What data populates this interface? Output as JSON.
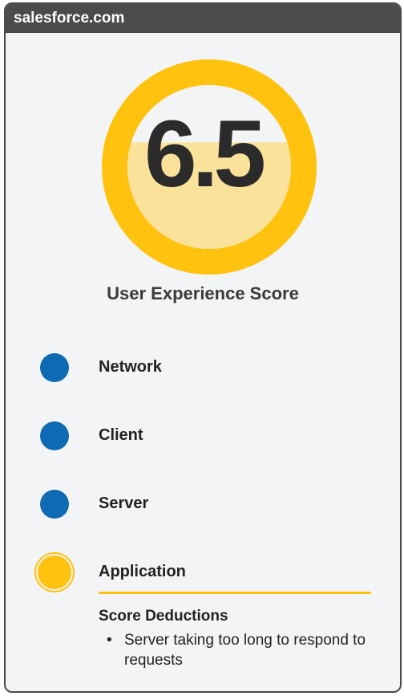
{
  "header": {
    "title": "salesforce.com"
  },
  "score": {
    "value": "6.5",
    "fill_fraction": 0.65,
    "title": "User Experience Score",
    "colors": {
      "ring": "#ffc20e",
      "fill": "#fbe29a",
      "background": "#f3f4f6"
    }
  },
  "factors": [
    {
      "label": "Network",
      "status": "ok",
      "color": "#0f6ab4"
    },
    {
      "label": "Client",
      "status": "ok",
      "color": "#0f6ab4"
    },
    {
      "label": "Server",
      "status": "ok",
      "color": "#0f6ab4"
    },
    {
      "label": "Application",
      "status": "warning",
      "color": "#ffc20e"
    }
  ],
  "deductions": {
    "title": "Score Deductions",
    "items": [
      "Server taking too long to respond to requests"
    ]
  }
}
